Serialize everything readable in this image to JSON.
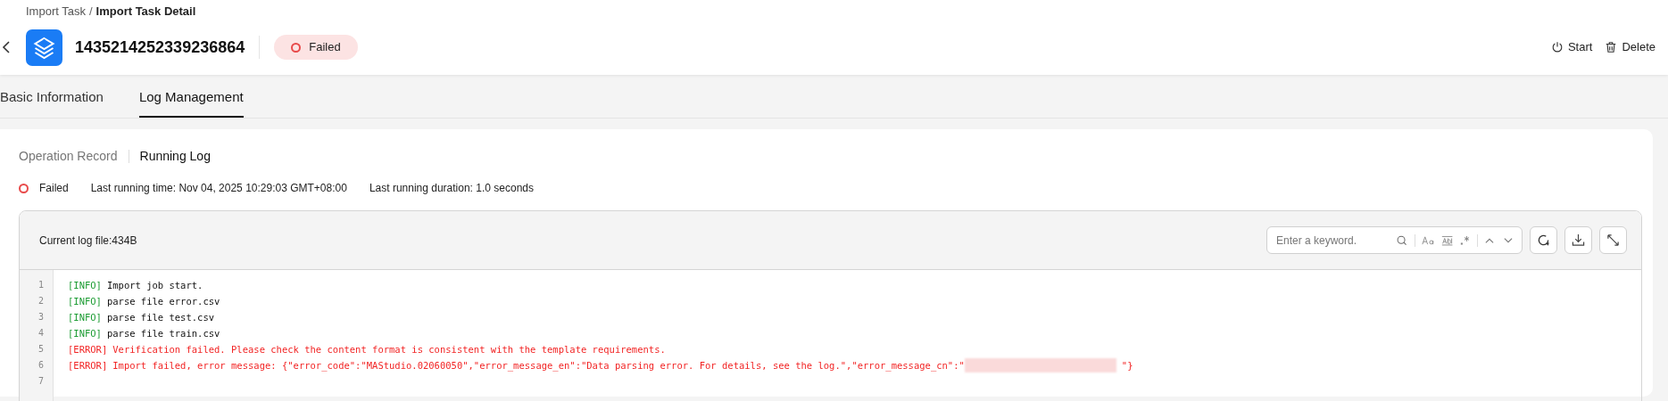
{
  "breadcrumb": [
    {
      "label": "Import Task",
      "current": false
    },
    {
      "separator": "/"
    },
    {
      "label": "Import Task Detail",
      "current": true
    }
  ],
  "header": {
    "title": "1435214252339236864",
    "status": {
      "label": "Failed",
      "kind": "failed"
    },
    "actions": [
      {
        "label": "Start",
        "kind": "start"
      },
      {
        "label": "Delete",
        "kind": "delete"
      }
    ]
  },
  "tabs": [
    {
      "label": "Basic Information",
      "selected": false
    },
    {
      "label": "Log Management",
      "selected": true
    }
  ],
  "subtabs": [
    {
      "label": "Operation Record",
      "selected": false
    },
    {
      "label": "Running Log",
      "selected": true
    }
  ],
  "run_info": {
    "status": {
      "label": "Failed",
      "kind": "failed"
    },
    "last_time": "Last running time: Nov 04, 2025 10:29:03 GMT+08:00",
    "duration": "Last running duration: 1.0 seconds"
  },
  "log": {
    "file_label": "Current log file:434B",
    "search": {
      "placeholder": "Enter a keyword."
    },
    "lines": [
      {
        "number": "1",
        "kind": "info",
        "tag": "[INFO]",
        "message": "Import job start."
      },
      {
        "number": "2",
        "kind": "info",
        "tag": "[INFO]",
        "message": "parse file error.csv"
      },
      {
        "number": "3",
        "kind": "info",
        "tag": "[INFO]",
        "message": "parse file test.csv"
      },
      {
        "number": "4",
        "kind": "info",
        "tag": "[INFO]",
        "message": "parse file train.csv"
      },
      {
        "number": "5",
        "kind": "error",
        "tag": "[ERROR]",
        "message": "Verification failed. Please check the content format is consistent with the template requirements."
      },
      {
        "number": "6",
        "kind": "error",
        "tag": "[ERROR]",
        "message": "Import failed, error message: {\"error_code\":\"MAStudio.02060050\",\"error_message_en\":\"Data parsing error. For details, see the log.\",\"error_message_cn\":\"",
        "redacted": true,
        "tail": "\"}"
      },
      {
        "number": "7",
        "kind": "empty"
      }
    ]
  }
}
